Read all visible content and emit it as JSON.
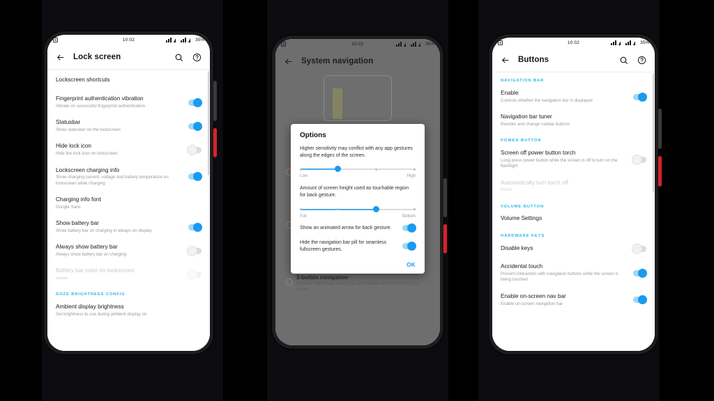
{
  "statusbar": {
    "time": "10:02",
    "battery": "35%"
  },
  "phone1": {
    "appbar": {
      "title": "Lock screen",
      "back": "back-arrow",
      "search": "search",
      "help": "help"
    },
    "items": [
      {
        "title": "Lockscreen shortcuts",
        "sub": "",
        "control": "none"
      },
      {
        "title": "Fingerprint authentication vibration",
        "sub": "Vibrate on successful fingerprint authentication",
        "control": "switch-on"
      },
      {
        "title": "Statusbar",
        "sub": "Show statusbar on the lockscreen",
        "control": "switch-on"
      },
      {
        "title": "Hide lock icon",
        "sub": "Hide the lock icon on lockscreen",
        "control": "switch-off"
      },
      {
        "title": "Lockscreen charging info",
        "sub": "Show charging current, voltage and battery temperature on lockscreen while charging",
        "control": "switch-on"
      },
      {
        "title": "Charging info font",
        "sub": "Google Sans",
        "control": "none"
      },
      {
        "title": "Show battery bar",
        "sub": "Show battery bar on charging in always on display",
        "control": "switch-on"
      },
      {
        "title": "Always show battery bar",
        "sub": "Always show battery bar on charging",
        "control": "switch-off"
      },
      {
        "title": "Battery bar color on lockscreen",
        "sub": "aaaaa",
        "control": "switch-off-disabled",
        "disabled": true
      }
    ],
    "section": "DOZE BRIGHTNESS CONFIG",
    "tail": {
      "title": "Ambient display brightness",
      "sub": "Set brightness to use during ambient display on"
    }
  },
  "phone2": {
    "appbar": {
      "title": "System navigation"
    },
    "option": {
      "title": "3-button navigation",
      "sub": "Go back, Home and switch apps with buttons at the bottom of your screen."
    },
    "dialog": {
      "title": "Options",
      "text1": "Higher sensitivity may conflict with any app gestures along the edges of the screen.",
      "slider1": {
        "left_label": "Low",
        "right_label": "High",
        "value_pct": 33
      },
      "text2": "Amount of screen height used as touchable region for back gesture.",
      "slider2": {
        "left_label": "Full",
        "right_label": "Bottom",
        "value_pct": 66
      },
      "toggle1": {
        "label": "Show an animated arrow for back gesture.",
        "control": "switch-on"
      },
      "toggle2": {
        "label": "Hide the navigation bar pill for seamless fullscreen gestures.",
        "control": "switch-on"
      },
      "ok": "OK"
    }
  },
  "phone3": {
    "appbar": {
      "title": "Buttons"
    },
    "sections": [
      {
        "header": "NAVIGATION BAR",
        "items": [
          {
            "title": "Enable",
            "sub": "Controls whether the navigation bar is displayed",
            "control": "switch-on"
          },
          {
            "title": "Navigation bar tuner",
            "sub": "Reorder and change navbar buttons",
            "control": "none"
          }
        ]
      },
      {
        "header": "POWER BUTTON",
        "items": [
          {
            "title": "Screen off power button torch",
            "sub": "Long press power button while the screen is off to turn on the flashlight",
            "control": "switch-off"
          },
          {
            "title": "Automatically turn torch off",
            "sub": "Never",
            "control": "none",
            "disabled": true
          }
        ]
      },
      {
        "header": "VOLUME BUTTON",
        "items": [
          {
            "title": "Volume Settings",
            "sub": "",
            "control": "none"
          }
        ]
      },
      {
        "header": "HARDWARE KEYS",
        "items": [
          {
            "title": "Disable keys",
            "sub": "",
            "control": "switch-off"
          },
          {
            "title": "Accidental touch",
            "sub": "Prevent interaction with navigation buttons while the screen is being touched",
            "control": "switch-on"
          },
          {
            "title": "Enable on-screen nav bar",
            "sub": "Enable on-screen navigation bar",
            "control": "switch-on"
          }
        ]
      }
    ]
  },
  "colors": {
    "accent": "#1a9bf0",
    "section": "#29b6e8",
    "power_button": "#d8232a",
    "panel": "#0b0b10"
  }
}
